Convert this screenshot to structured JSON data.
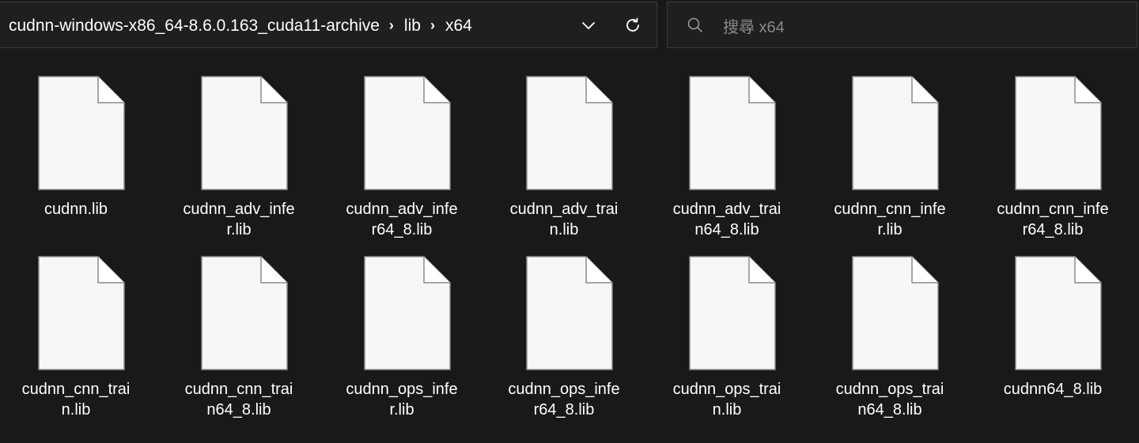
{
  "address_bar": {
    "breadcrumbs": [
      "cudnn-windows-x86_64-8.6.0.163_cuda11-archive",
      "lib",
      "x64"
    ],
    "separator": "›"
  },
  "search": {
    "placeholder": "搜尋 x64"
  },
  "files": [
    {
      "name": "cudnn.lib",
      "lines": [
        "cudnn.lib"
      ]
    },
    {
      "name": "cudnn_adv_infer.lib",
      "lines": [
        "cudnn_adv_infe",
        "r.lib"
      ]
    },
    {
      "name": "cudnn_adv_infer64_8.lib",
      "lines": [
        "cudnn_adv_infe",
        "r64_8.lib"
      ]
    },
    {
      "name": "cudnn_adv_train.lib",
      "lines": [
        "cudnn_adv_trai",
        "n.lib"
      ]
    },
    {
      "name": "cudnn_adv_train64_8.lib",
      "lines": [
        "cudnn_adv_trai",
        "n64_8.lib"
      ]
    },
    {
      "name": "cudnn_cnn_infer.lib",
      "lines": [
        "cudnn_cnn_infe",
        "r.lib"
      ]
    },
    {
      "name": "cudnn_cnn_infer64_8.lib",
      "lines": [
        "cudnn_cnn_infe",
        "r64_8.lib"
      ]
    },
    {
      "name": "cudnn_cnn_train.lib",
      "lines": [
        "cudnn_cnn_trai",
        "n.lib"
      ]
    },
    {
      "name": "cudnn_cnn_train64_8.lib",
      "lines": [
        "cudnn_cnn_trai",
        "n64_8.lib"
      ]
    },
    {
      "name": "cudnn_ops_infer.lib",
      "lines": [
        "cudnn_ops_infe",
        "r.lib"
      ]
    },
    {
      "name": "cudnn_ops_infer64_8.lib",
      "lines": [
        "cudnn_ops_infe",
        "r64_8.lib"
      ]
    },
    {
      "name": "cudnn_ops_train.lib",
      "lines": [
        "cudnn_ops_trai",
        "n.lib"
      ]
    },
    {
      "name": "cudnn_ops_train64_8.lib",
      "lines": [
        "cudnn_ops_trai",
        "n64_8.lib"
      ]
    },
    {
      "name": "cudnn64_8.lib",
      "lines": [
        "cudnn64_8.lib"
      ]
    }
  ],
  "icons": {
    "dropdown": "chevron-down-icon",
    "refresh": "refresh-icon",
    "search": "search-icon",
    "file": "file-icon"
  },
  "colors": {
    "background": "#191919",
    "text": "#ffffff",
    "placeholder": "#8a8a8a",
    "border": "#3a3a3a"
  }
}
